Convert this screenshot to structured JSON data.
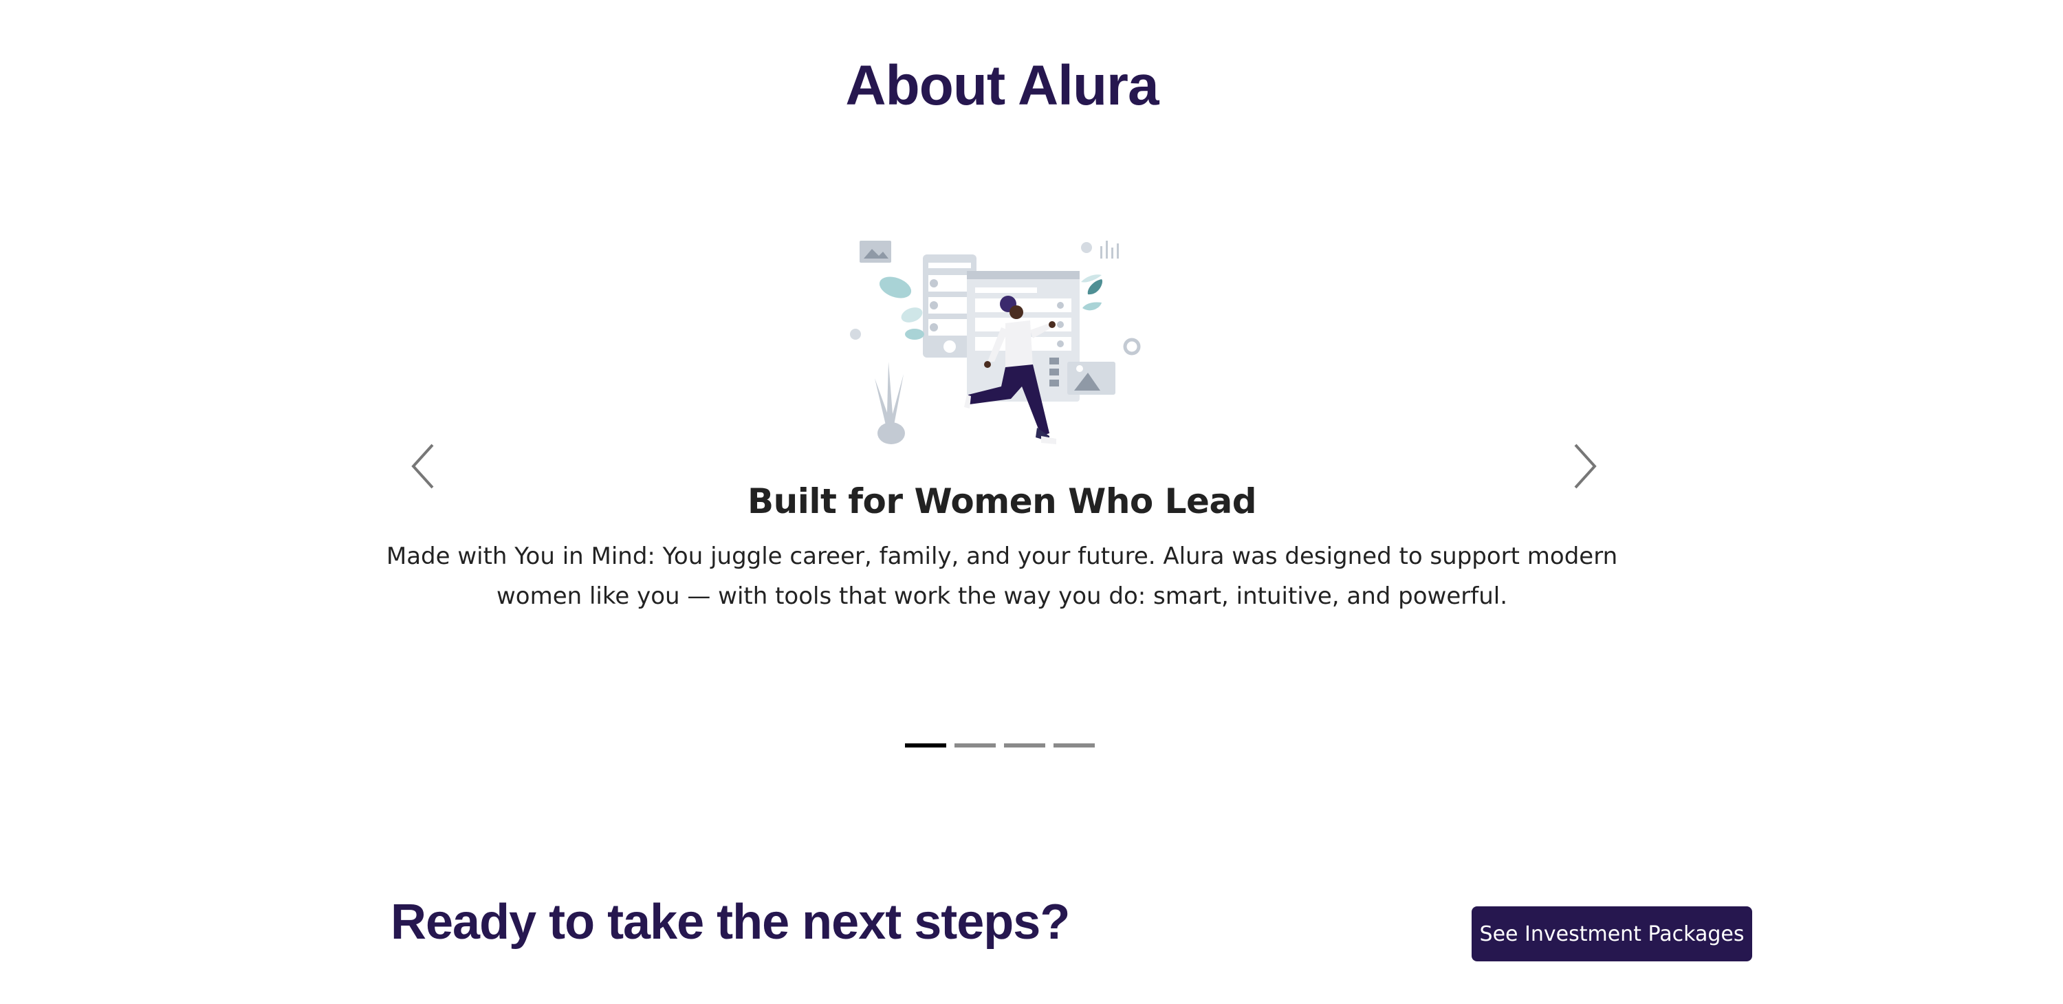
{
  "about": {
    "title": "About Alura"
  },
  "carousel": {
    "prev_icon": "chevron-left-icon",
    "next_icon": "chevron-right-icon",
    "active_index": 0,
    "slide_count": 4,
    "slide": {
      "illustration": "woman-walking-with-dashboard-illustration",
      "heading": "Built for Women Who Lead",
      "body": "Made with You in Mind: You juggle career, family, and your future. Alura was designed to support modern women like you — with tools that work the way you do: smart, intuitive, and powerful."
    }
  },
  "cta": {
    "title": "Ready to take the next steps?",
    "button_label": "See Investment Packages"
  },
  "colors": {
    "brand": "#26174f",
    "text": "#222222",
    "indicator_active": "#000000",
    "indicator_inactive": "#8a8a8a"
  }
}
